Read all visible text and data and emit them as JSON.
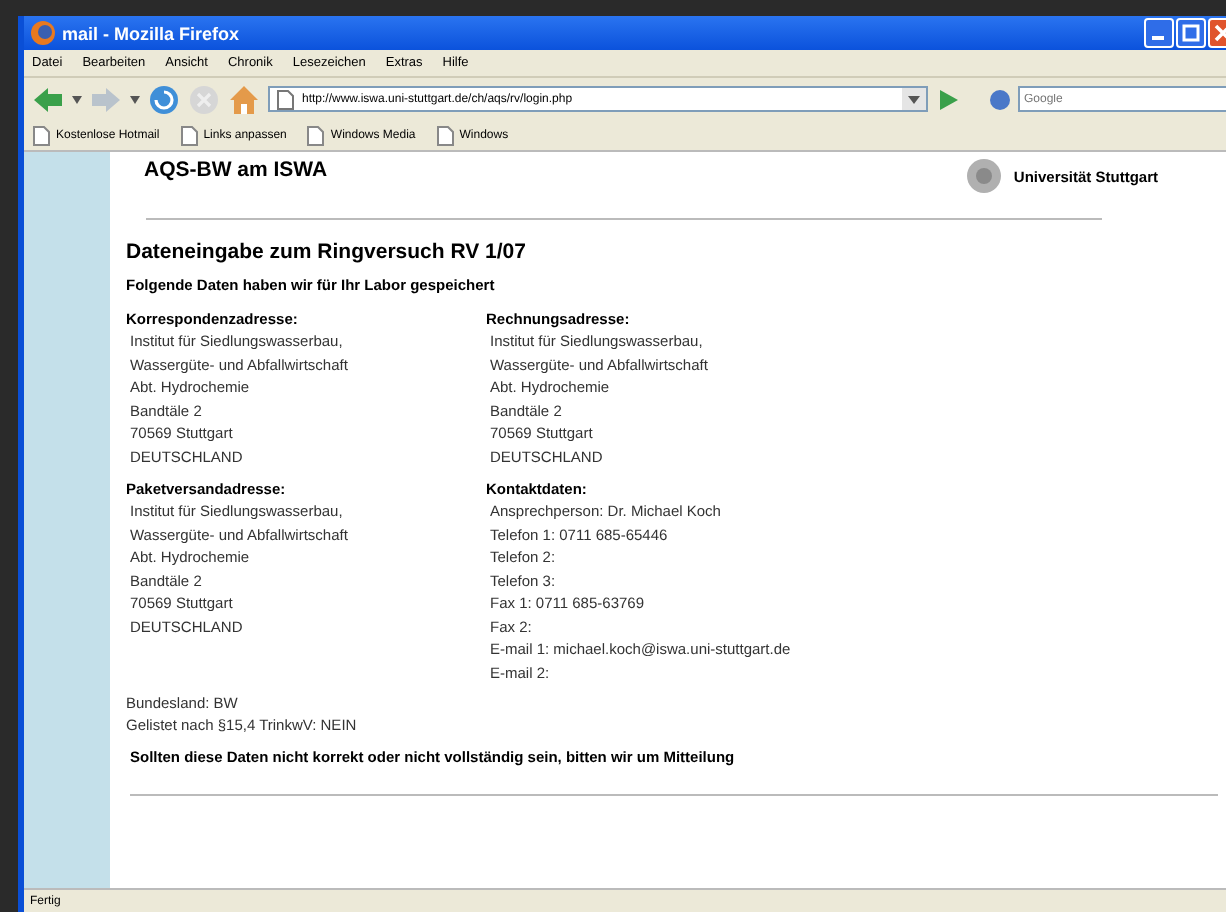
{
  "window": {
    "title": "mail - Mozilla Firefox"
  },
  "menu": [
    "Datei",
    "Bearbeiten",
    "Ansicht",
    "Chronik",
    "Lesezeichen",
    "Extras",
    "Hilfe"
  ],
  "address_bar": {
    "value": "http://www.iswa.uni-stuttgart.de/ch/aqs/rv/login.php"
  },
  "search": {
    "placeholder": "Google"
  },
  "bookmarks": [
    "Kostenlose Hotmail",
    "Links anpassen",
    "Windows Media",
    "Windows"
  ],
  "page": {
    "site_title": "AQS-BW am ISWA",
    "university": "Universität Stuttgart",
    "heading": "Dateneingabe zum Ringversuch RV 1/07",
    "subheading": "Folgende Daten haben wir für Ihr Labor gespeichert",
    "sections": [
      {
        "title": "Korrespondenzadresse:",
        "lines": [
          "Institut für Siedlungswasserbau,",
          "Wassergüte- und Abfallwirtschaft",
          "Abt. Hydrochemie",
          "Bandtäle 2",
          "70569 Stuttgart",
          "DEUTSCHLAND"
        ]
      },
      {
        "title": "Rechnungsadresse:",
        "lines": [
          "Institut für Siedlungswasserbau,",
          "Wassergüte- und Abfallwirtschaft",
          "Abt. Hydrochemie",
          "Bandtäle 2",
          "70569 Stuttgart",
          "DEUTSCHLAND"
        ]
      },
      {
        "title": "Paketversandadresse:",
        "lines": [
          "Institut für Siedlungswasserbau,",
          "Wassergüte- und Abfallwirtschaft",
          "Abt. Hydrochemie",
          "Bandtäle 2",
          "70569 Stuttgart",
          "DEUTSCHLAND"
        ]
      },
      {
        "title": "Kontaktdaten:",
        "lines": [
          "Ansprechperson: Dr. Michael Koch",
          "Telefon 1: 0711 685-65446",
          "Telefon 2:",
          "Telefon 3:",
          "Fax 1: 0711 685-63769",
          "Fax 2:",
          "E-mail 1: michael.koch@iswa.uni-stuttgart.de",
          "E-mail 2:"
        ]
      }
    ],
    "info_lines": [
      "Bundesland: BW",
      "Gelistet nach §15,4 TrinkwV: NEIN"
    ],
    "notice": "Sollten diese Daten nicht korrekt oder nicht vollständig sein, bitten wir um Mitteilung"
  },
  "status_bar": {
    "text": "Fertig"
  }
}
